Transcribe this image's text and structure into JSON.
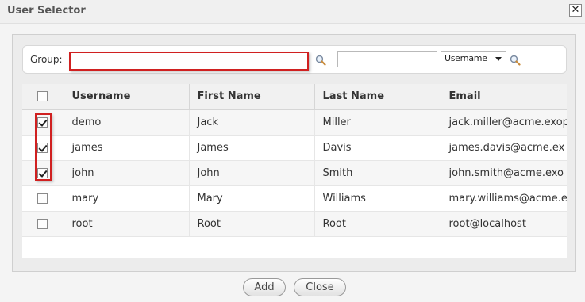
{
  "dialog": {
    "title": "User Selector",
    "close_glyph": "✕"
  },
  "filter": {
    "group_label": "Group:",
    "group_value": "",
    "search_value": "",
    "search_field_selected": "Username"
  },
  "table": {
    "headers": {
      "username": "Username",
      "first_name": "First Name",
      "last_name": "Last Name",
      "email": "Email"
    },
    "rows": [
      {
        "checked": true,
        "username": "demo",
        "first_name": "Jack",
        "last_name": "Miller",
        "email": "jack.miller@acme.exop"
      },
      {
        "checked": true,
        "username": "james",
        "first_name": "James",
        "last_name": "Davis",
        "email": "james.davis@acme.ex"
      },
      {
        "checked": true,
        "username": "john",
        "first_name": "John",
        "last_name": "Smith",
        "email": "john.smith@acme.exo"
      },
      {
        "checked": false,
        "username": "mary",
        "first_name": "Mary",
        "last_name": "Williams",
        "email": "mary.williams@acme.e"
      },
      {
        "checked": false,
        "username": "root",
        "first_name": "Root",
        "last_name": "Root",
        "email": "root@localhost"
      }
    ]
  },
  "buttons": {
    "add": "Add",
    "close": "Close"
  },
  "icons": {
    "search": "magnifier-icon"
  },
  "colors": {
    "highlight": "#d02020"
  }
}
